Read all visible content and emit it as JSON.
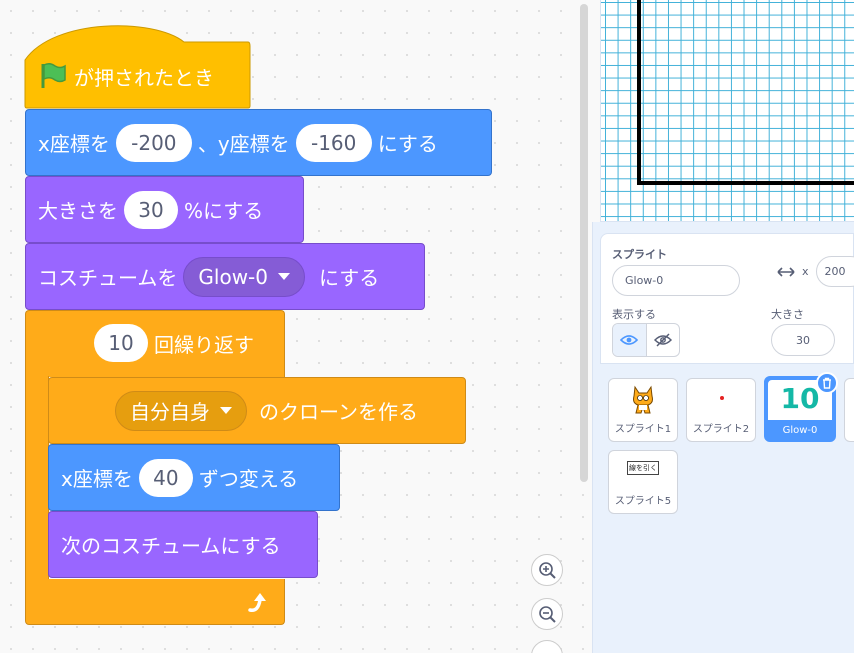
{
  "blocks": {
    "hat": {
      "label": "が押されたとき"
    },
    "goto": {
      "label1": "x座標を",
      "x": "-200",
      "label2": "、y座標を",
      "y": "-160",
      "label3": "にする"
    },
    "size": {
      "label1": "大きさを",
      "value": "30",
      "label2": "%にする"
    },
    "costume": {
      "label1": "コスチュームを",
      "menu": "Glow-0",
      "label2": "にする"
    },
    "repeat": {
      "count": "10",
      "label": "回繰り返す"
    },
    "clone": {
      "menu": "自分自身",
      "label": "のクローンを作る"
    },
    "changex": {
      "label1": "x座標を",
      "value": "40",
      "label2": "ずつ変える"
    },
    "next": {
      "label": "次のコスチュームにする"
    }
  },
  "sprite_info": {
    "sprite_label": "スプライト",
    "name": "Glow-0",
    "x_label": "x",
    "x": "200",
    "show_label": "表示する",
    "size_label": "大きさ",
    "size": "30"
  },
  "sprites": [
    {
      "name": "スプライト1",
      "icon": "cat-icon"
    },
    {
      "name": "スプライト2",
      "icon": "red-dot-icon"
    },
    {
      "name": "Glow-0",
      "icon": "glow-10-icon",
      "thumb_text": "10",
      "selected": true
    },
    {
      "name": "スプライト5",
      "icon": "text-image-icon",
      "thumb_text": "線を引く"
    }
  ],
  "colors": {
    "motion": "#4c97ff",
    "looks": "#9966ff",
    "control": "#ffab19",
    "events": "#ffbf00",
    "accent": "#4c97ff"
  }
}
